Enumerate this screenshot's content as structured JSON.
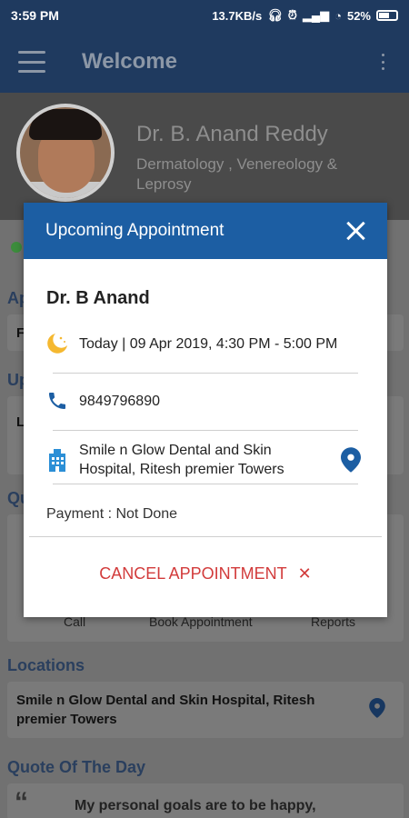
{
  "status_bar": {
    "time": "3:59 PM",
    "network_speed": "13.7KB/s",
    "battery": "52%"
  },
  "app_bar": {
    "title": "Welcome"
  },
  "profile": {
    "name": "Dr. B. Anand Reddy",
    "specialization": "Dermatology , Venereology & Leprosy"
  },
  "background": {
    "section_ap": "Ap",
    "item_f": "F",
    "section_up": "Up",
    "item_l": "L",
    "section_qu": "Qu",
    "quick_actions": [
      "Call",
      "Book Appointment",
      "Reports"
    ],
    "locations_title": "Locations",
    "location_name": "Smile n Glow Dental and Skin Hospital, Ritesh premier Towers",
    "quote_title": "Quote Of The Day",
    "quote_text": "My personal goals are to be happy,"
  },
  "dialog": {
    "title": "Upcoming Appointment",
    "doctor": "Dr. B Anand",
    "datetime": "Today | 09 Apr 2019, 4:30 PM - 5:00 PM",
    "phone": "9849796890",
    "hospital": "Smile n Glow Dental and Skin Hospital, Ritesh premier Towers",
    "payment": "Payment : Not Done",
    "cancel_label": "CANCEL APPOINTMENT",
    "cancel_icon": "✕"
  },
  "colors": {
    "primary": "#1f3a5f",
    "dialog_header": "#1c5ea3",
    "cancel": "#d23b3b",
    "icon_blue": "#1c5ea3",
    "moon": "#f5b830"
  }
}
